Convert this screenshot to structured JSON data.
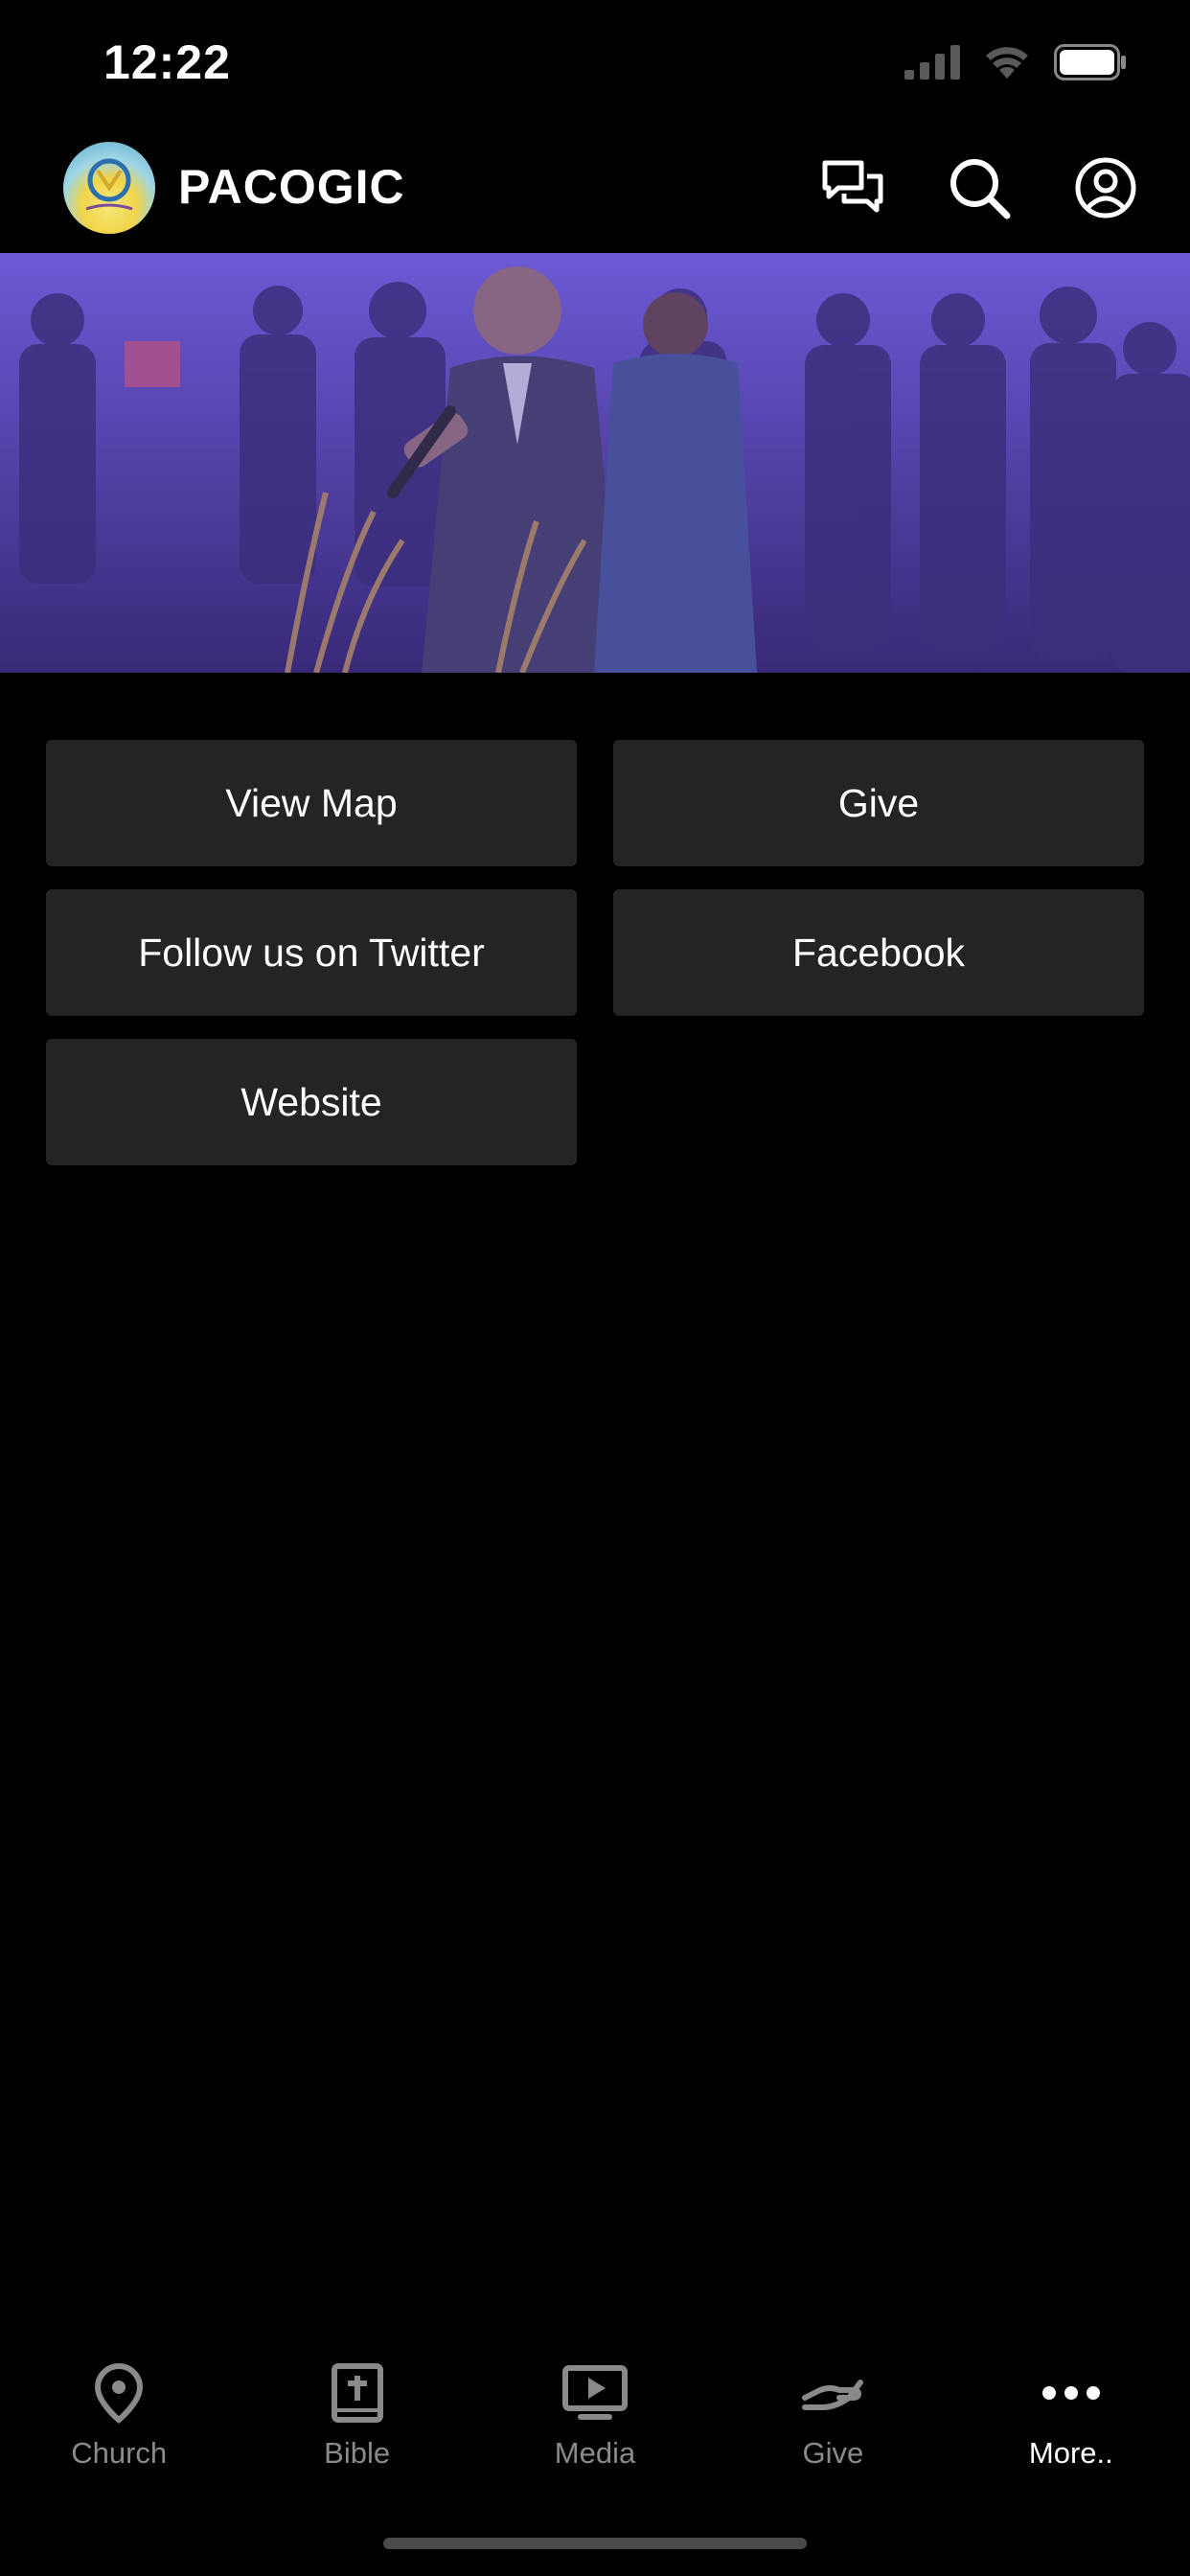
{
  "status_bar": {
    "time": "12:22"
  },
  "header": {
    "title": "PACOGIC",
    "actions": [
      {
        "icon": "chat-icon"
      },
      {
        "icon": "search-icon"
      },
      {
        "icon": "account-icon"
      }
    ]
  },
  "actions": [
    {
      "label": "View Map"
    },
    {
      "label": "Give"
    },
    {
      "label": "Follow us on Twitter"
    },
    {
      "label": "Facebook"
    },
    {
      "label": "Website"
    }
  ],
  "tab_bar": {
    "tabs": [
      {
        "label": "Church",
        "icon": "location-pin-icon"
      },
      {
        "label": "Bible",
        "icon": "bible-icon"
      },
      {
        "label": "Media",
        "icon": "play-screen-icon"
      },
      {
        "label": "Give",
        "icon": "hand-give-icon"
      },
      {
        "label": "More..",
        "icon": "more-dots-icon"
      }
    ],
    "active": "More..",
    "inactive_color": "#8a8a8a",
    "active_color": "#ffffff"
  },
  "colors": {
    "background": "#000000",
    "button_background": "#242424",
    "hero_tint": "#5a3fb0"
  }
}
